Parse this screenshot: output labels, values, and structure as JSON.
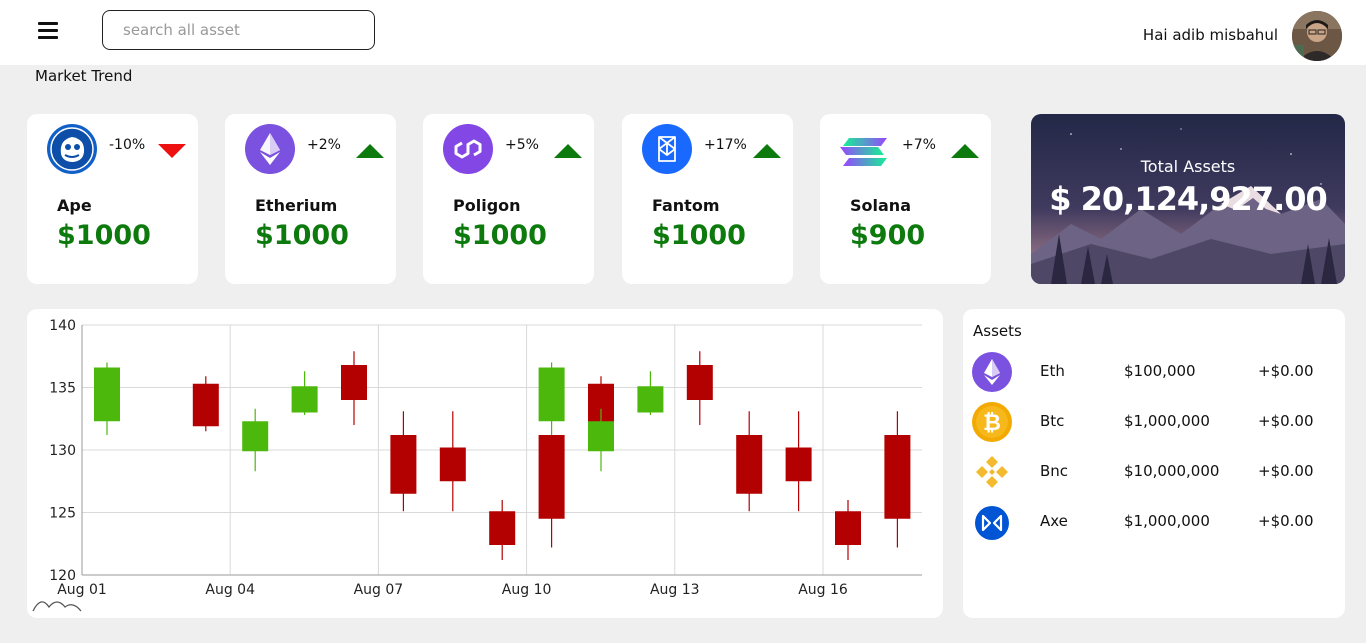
{
  "header": {
    "search_placeholder": "search all asset",
    "greeting": "Hai adib misbahul"
  },
  "section_title": "Market Trend",
  "coins": [
    {
      "name": "Ape",
      "change": "-10%",
      "direction": "down",
      "price": "$1000",
      "icon": "ape-icon",
      "color": "#1060c8"
    },
    {
      "name": "Etherium",
      "change": "+2%",
      "direction": "up",
      "price": "$1000",
      "icon": "ethereum-icon",
      "color": "#7b52e0"
    },
    {
      "name": "Poligon",
      "change": "+5%",
      "direction": "up",
      "price": "$1000",
      "icon": "polygon-icon",
      "color": "#8247e5"
    },
    {
      "name": "Fantom",
      "change": "+17%",
      "direction": "up",
      "price": "$1000",
      "icon": "fantom-icon",
      "color": "#1969ff"
    },
    {
      "name": "Solana",
      "change": "+7%",
      "direction": "up",
      "price": "$900",
      "icon": "solana-icon",
      "color": "#9945ff"
    }
  ],
  "total_assets": {
    "label": "Total Assets",
    "value": "$ 20,124,927.00"
  },
  "assets": {
    "title": "Assets",
    "rows": [
      {
        "name": "Eth",
        "amount": "$100,000",
        "change": "+$0.00",
        "icon": "ethereum-icon"
      },
      {
        "name": "Btc",
        "amount": "$1,000,000",
        "change": "+$0.00",
        "icon": "bitcoin-icon"
      },
      {
        "name": "Bnc",
        "amount": "$10,000,000",
        "change": "+$0.00",
        "icon": "binance-icon"
      },
      {
        "name": "Axe",
        "amount": "$1,000,000",
        "change": "+$0.00",
        "icon": "axie-icon"
      }
    ]
  },
  "colors": {
    "up": "#4cb80c",
    "down": "#b30000",
    "price_green": "#0d7a0d"
  },
  "chart_data": {
    "type": "candlestick",
    "ylim": [
      120,
      140
    ],
    "y_ticks": [
      120,
      125,
      130,
      135,
      140
    ],
    "x_ticks": [
      "Aug 01",
      "Aug 04",
      "Aug 07",
      "Aug 10",
      "Aug 13",
      "Aug 16"
    ],
    "grid": true,
    "candles": [
      {
        "day": 1,
        "open": 132.3,
        "close": 136.6,
        "high": 137.0,
        "low": 131.2
      },
      {
        "day": 3,
        "open": 135.3,
        "close": 131.9,
        "high": 135.9,
        "low": 131.5
      },
      {
        "day": 4,
        "open": 129.9,
        "close": 132.3,
        "high": 133.3,
        "low": 128.3
      },
      {
        "day": 5,
        "open": 133.0,
        "close": 135.1,
        "high": 136.3,
        "low": 132.8
      },
      {
        "day": 6,
        "open": 136.8,
        "close": 134.0,
        "high": 137.9,
        "low": 132.0
      },
      {
        "day": 7,
        "open": 131.2,
        "close": 126.5,
        "high": 133.1,
        "low": 125.1
      },
      {
        "day": 8,
        "open": 130.2,
        "close": 127.5,
        "high": 133.1,
        "low": 125.1
      },
      {
        "day": 9,
        "open": 125.1,
        "close": 122.4,
        "high": 126.0,
        "low": 121.2
      },
      {
        "day": 10,
        "open": 131.2,
        "close": 124.5,
        "high": 131.2,
        "low": 122.2
      },
      {
        "day": 10,
        "open": 132.3,
        "close": 136.6,
        "high": 137.0,
        "low": 131.2
      },
      {
        "day": 11,
        "open": 135.3,
        "close": 131.9,
        "high": 135.9,
        "low": 131.5
      },
      {
        "day": 11,
        "open": 129.9,
        "close": 132.3,
        "high": 133.3,
        "low": 128.3
      },
      {
        "day": 12,
        "open": 133.0,
        "close": 135.1,
        "high": 136.3,
        "low": 132.8
      },
      {
        "day": 13,
        "open": 136.8,
        "close": 134.0,
        "high": 137.9,
        "low": 132.0
      },
      {
        "day": 14,
        "open": 131.2,
        "close": 126.5,
        "high": 133.1,
        "low": 125.1
      },
      {
        "day": 15,
        "open": 130.2,
        "close": 127.5,
        "high": 133.1,
        "low": 125.1
      },
      {
        "day": 16,
        "open": 125.1,
        "close": 122.4,
        "high": 126.0,
        "low": 121.2
      },
      {
        "day": 17,
        "open": 131.2,
        "close": 124.5,
        "high": 133.1,
        "low": 122.2
      }
    ]
  }
}
